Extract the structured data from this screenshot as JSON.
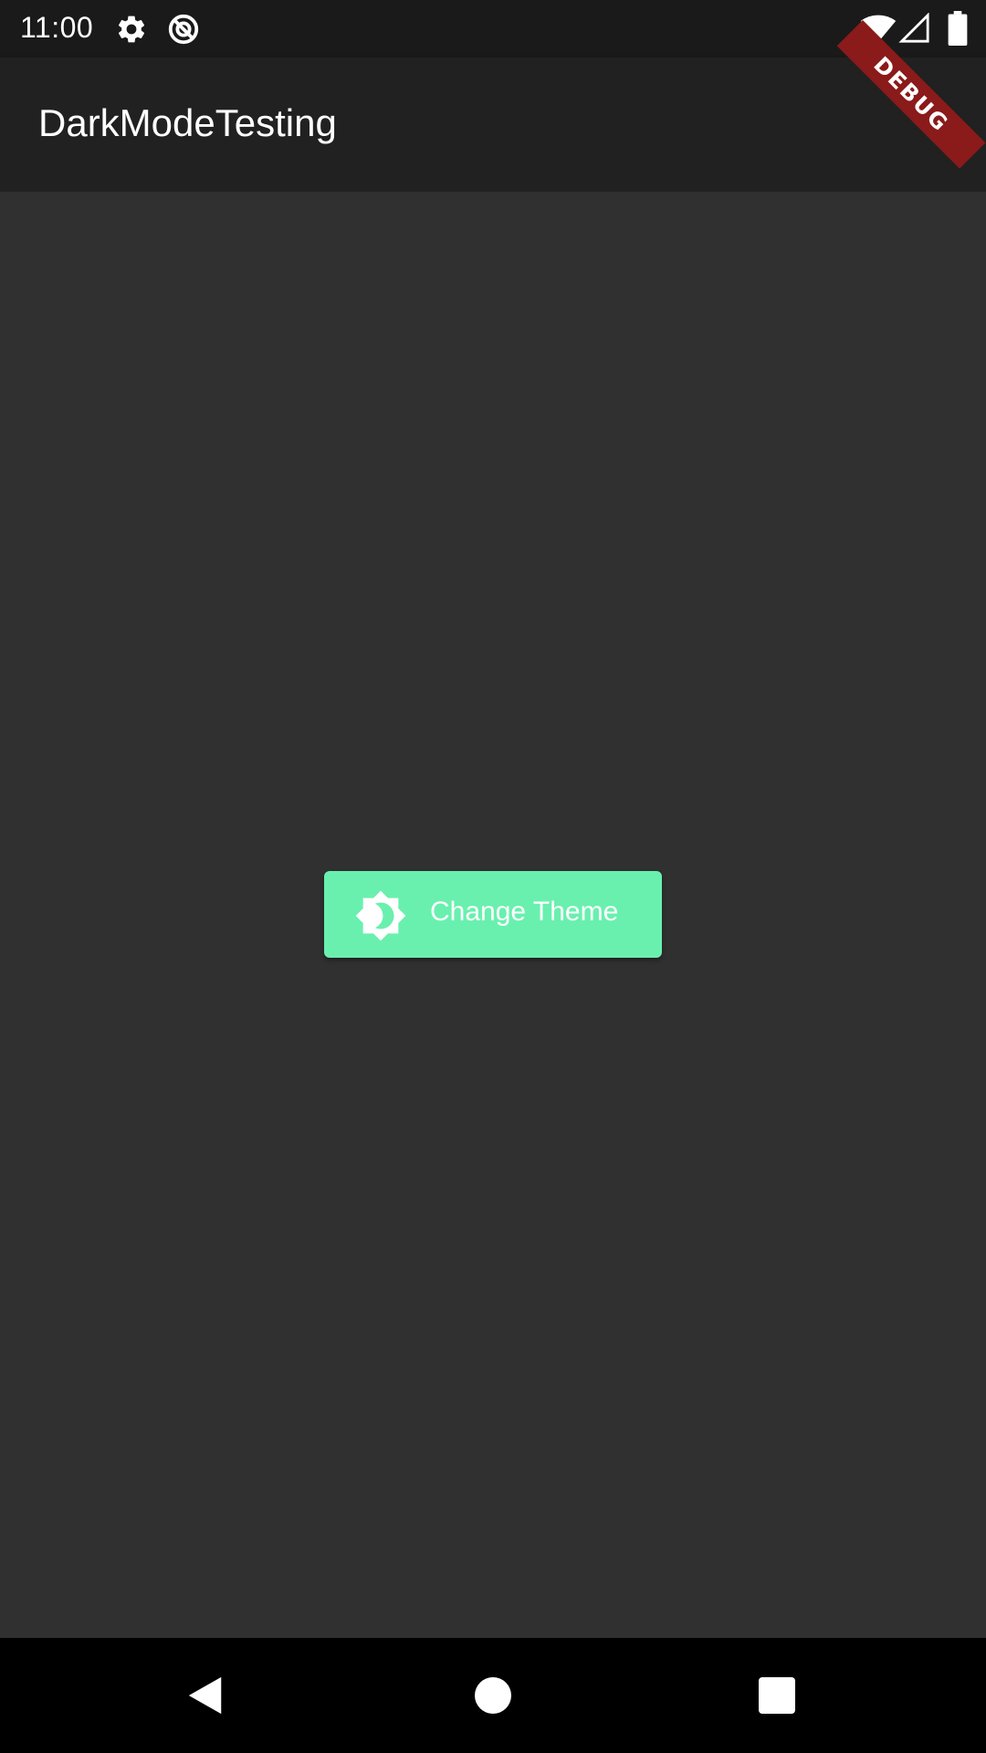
{
  "status_bar": {
    "time": "11:00",
    "icons": [
      "gear-icon",
      "data-saver-icon",
      "wifi-icon",
      "cell-signal-icon",
      "battery-icon"
    ]
  },
  "app_bar": {
    "title": "DarkModeTesting"
  },
  "main": {
    "change_theme_button": {
      "label": "Change Theme",
      "icon": "brightness-icon",
      "background": "#69f0ae"
    }
  },
  "nav_bar": {
    "buttons": [
      "back-icon",
      "home-icon",
      "recents-icon"
    ]
  },
  "debug_banner": {
    "label": "DEBUG"
  },
  "colors": {
    "background": "#303030",
    "app_bar": "#212121",
    "accent": "#69f0ae",
    "debug": "#8b1a1a"
  }
}
